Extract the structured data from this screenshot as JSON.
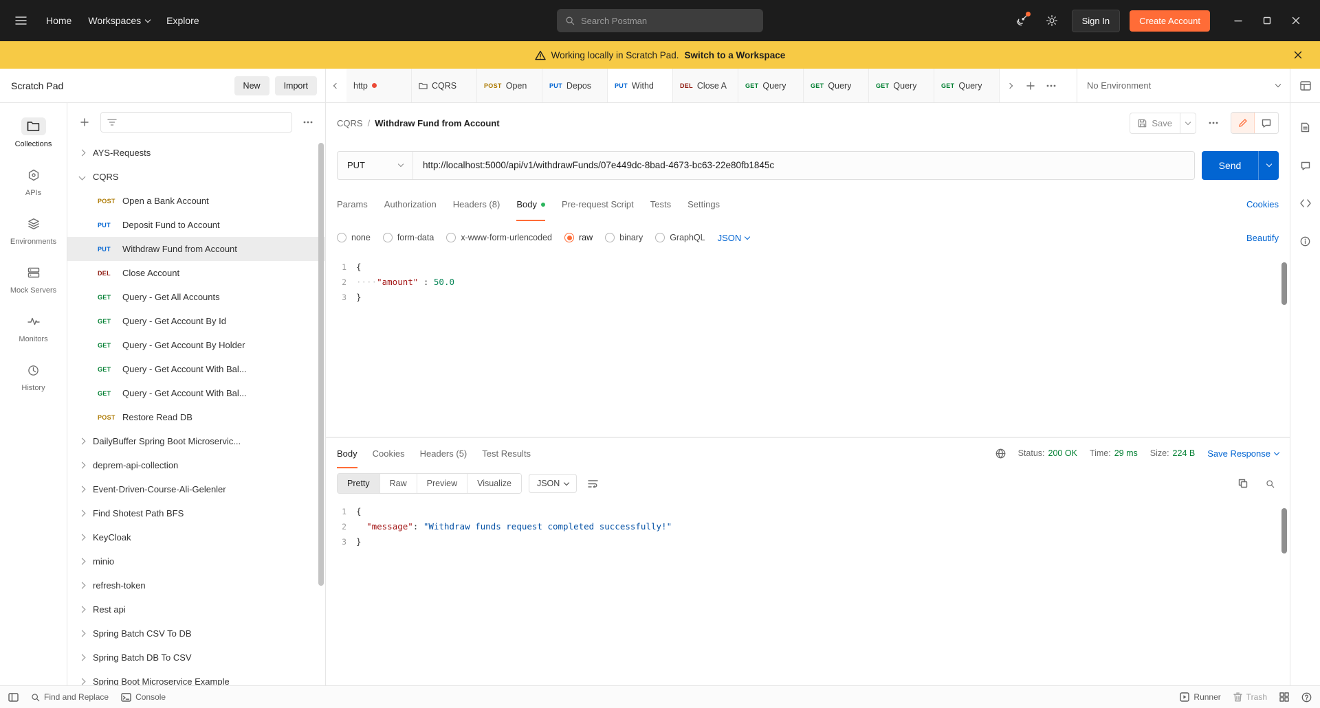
{
  "colors": {
    "accent": "#FF6C37",
    "blue": "#0265D2",
    "green": "#007F31",
    "banner": "#F7CA45",
    "methods": {
      "GET": "#007F31",
      "POST": "#AD7A03",
      "PUT": "#0265D2",
      "DEL": "#8E1A10"
    }
  },
  "topbar": {
    "home": "Home",
    "workspaces": "Workspaces",
    "explore": "Explore",
    "search_placeholder": "Search Postman",
    "sign_in": "Sign In",
    "create_account": "Create Account"
  },
  "banner": {
    "text": "Working locally in Scratch Pad.",
    "link": "Switch to a Workspace"
  },
  "sidebar": {
    "title": "Scratch Pad",
    "new_button": "New",
    "import_button": "Import",
    "rail": [
      {
        "label": "Collections",
        "icon": "collections-icon",
        "active": true
      },
      {
        "label": "APIs",
        "icon": "apis-icon"
      },
      {
        "label": "Environments",
        "icon": "environments-icon"
      },
      {
        "label": "Mock Servers",
        "icon": "mock-servers-icon"
      },
      {
        "label": "Monitors",
        "icon": "monitors-icon"
      },
      {
        "label": "History",
        "icon": "history-icon"
      }
    ],
    "tree": [
      {
        "type": "folder",
        "label": "AYS-Requests",
        "expanded": false
      },
      {
        "type": "folder",
        "label": "CQRS",
        "expanded": true
      },
      {
        "type": "request",
        "method": "POST",
        "label": "Open a Bank Account"
      },
      {
        "type": "request",
        "method": "PUT",
        "label": "Deposit Fund to Account"
      },
      {
        "type": "request",
        "method": "PUT",
        "label": "Withdraw Fund from Account",
        "selected": true
      },
      {
        "type": "request",
        "method": "DEL",
        "label": "Close Account"
      },
      {
        "type": "request",
        "method": "GET",
        "label": "Query - Get All Accounts"
      },
      {
        "type": "request",
        "method": "GET",
        "label": "Query - Get Account By Id"
      },
      {
        "type": "request",
        "method": "GET",
        "label": "Query - Get Account By Holder"
      },
      {
        "type": "request",
        "method": "GET",
        "label": "Query - Get Account With Bal..."
      },
      {
        "type": "request",
        "method": "GET",
        "label": "Query - Get Account With Bal..."
      },
      {
        "type": "request",
        "method": "POST",
        "label": "Restore Read DB"
      },
      {
        "type": "folder",
        "label": "DailyBuffer Spring Boot Microservic..."
      },
      {
        "type": "folder",
        "label": "deprem-api-collection"
      },
      {
        "type": "folder",
        "label": "Event-Driven-Course-Ali-Gelenler"
      },
      {
        "type": "folder",
        "label": "Find Shotest Path BFS"
      },
      {
        "type": "folder",
        "label": "KeyCloak"
      },
      {
        "type": "folder",
        "label": "minio"
      },
      {
        "type": "folder",
        "label": "refresh-token"
      },
      {
        "type": "folder",
        "label": "Rest api"
      },
      {
        "type": "folder",
        "label": "Spring Batch CSV To DB"
      },
      {
        "type": "folder",
        "label": "Spring Batch DB To CSV"
      },
      {
        "type": "folder",
        "label": "Spring Boot Microservice Example"
      }
    ]
  },
  "tabs": {
    "items": [
      {
        "label": "http",
        "unsaved": true
      },
      {
        "label": "CQRS",
        "icon": "collection"
      },
      {
        "method": "POST",
        "label": "Open"
      },
      {
        "method": "PUT",
        "label": "Depos"
      },
      {
        "method": "PUT",
        "label": "Withd",
        "active": true
      },
      {
        "method": "DEL",
        "label": "Close A"
      },
      {
        "method": "GET",
        "label": "Query"
      },
      {
        "method": "GET",
        "label": "Query"
      },
      {
        "method": "GET",
        "label": "Query"
      },
      {
        "method": "GET",
        "label": "Query"
      }
    ],
    "environment": "No Environment"
  },
  "request": {
    "collection": "CQRS",
    "name": "Withdraw Fund from Account",
    "save_label": "Save",
    "method": "PUT",
    "url": "http://localhost:5000/api/v1/withdrawFunds/07e449dc-8bad-4673-bc63-22e80fb1845c",
    "send_label": "Send",
    "tabs": [
      {
        "label": "Params"
      },
      {
        "label": "Authorization"
      },
      {
        "label": "Headers (8)"
      },
      {
        "label": "Body",
        "active": true,
        "dot": true
      },
      {
        "label": "Pre-request Script"
      },
      {
        "label": "Tests"
      },
      {
        "label": "Settings"
      }
    ],
    "cookies_link": "Cookies",
    "body_types": [
      {
        "label": "none"
      },
      {
        "label": "form-data"
      },
      {
        "label": "x-www-form-urlencoded"
      },
      {
        "label": "raw",
        "selected": true
      },
      {
        "label": "binary"
      },
      {
        "label": "GraphQL"
      }
    ],
    "format": "JSON",
    "beautify_link": "Beautify",
    "body_lines": [
      {
        "num": "1",
        "tokens": [
          {
            "t": "punct",
            "v": "{"
          }
        ]
      },
      {
        "num": "2",
        "tokens": [
          {
            "t": "ws",
            "v": "····"
          },
          {
            "t": "key",
            "v": "\"amount\""
          },
          {
            "t": "punct",
            "v": " : "
          },
          {
            "t": "num",
            "v": "50.0"
          }
        ]
      },
      {
        "num": "3",
        "tokens": [
          {
            "t": "punct",
            "v": "}"
          }
        ]
      }
    ]
  },
  "response": {
    "tabs": [
      {
        "label": "Body",
        "active": true
      },
      {
        "label": "Cookies"
      },
      {
        "label": "Headers (5)"
      },
      {
        "label": "Test Results"
      }
    ],
    "meta": [
      {
        "label": "Status:",
        "value": "200 OK"
      },
      {
        "label": "Time:",
        "value": "29 ms"
      },
      {
        "label": "Size:",
        "value": "224 B"
      }
    ],
    "save_response": "Save Response",
    "view_tabs": [
      {
        "label": "Pretty",
        "active": true
      },
      {
        "label": "Raw"
      },
      {
        "label": "Preview"
      },
      {
        "label": "Visualize"
      }
    ],
    "format": "JSON",
    "lines": [
      {
        "num": "1",
        "tokens": [
          {
            "t": "punct",
            "v": "{"
          }
        ]
      },
      {
        "num": "2",
        "tokens": [
          {
            "t": "ws",
            "v": "  "
          },
          {
            "t": "key",
            "v": "\"message\""
          },
          {
            "t": "punct",
            "v": ": "
          },
          {
            "t": "str",
            "v": "\"Withdraw funds request completed successfully!\""
          }
        ]
      },
      {
        "num": "3",
        "tokens": [
          {
            "t": "punct",
            "v": "}"
          }
        ]
      }
    ]
  },
  "statusbar": {
    "find": "Find and Replace",
    "console": "Console",
    "runner": "Runner",
    "trash": "Trash"
  }
}
